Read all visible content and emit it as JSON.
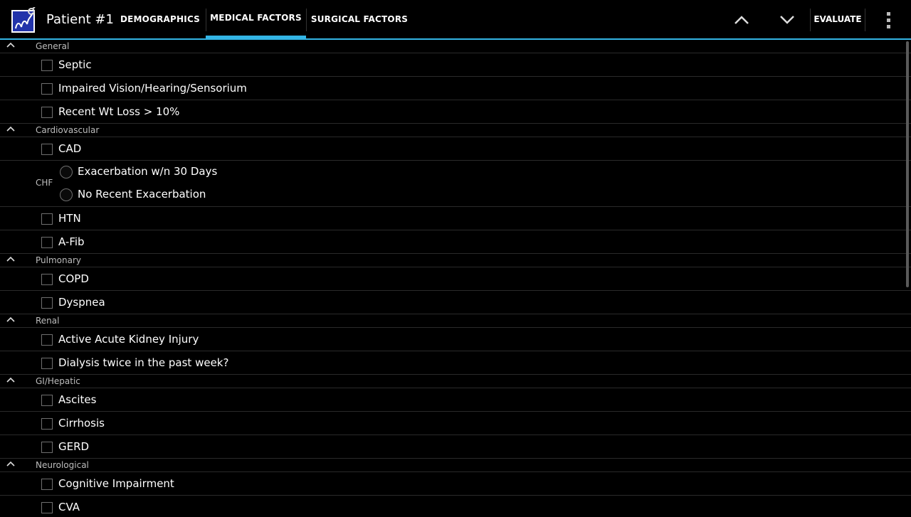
{
  "app": {
    "title": "Patient #1",
    "logo_icon": "vascular-surgery-logo-icon"
  },
  "tabs": [
    {
      "label": "DEMOGRAPHICS",
      "active": false
    },
    {
      "label": "MEDICAL FACTORS",
      "active": true
    },
    {
      "label": "SURGICAL FACTORS",
      "active": false
    }
  ],
  "actions": {
    "evaluate_label": "EVALUATE"
  },
  "colors": {
    "accent": "#33b5e5",
    "background": "#000000",
    "divider": "#2a2a2a"
  },
  "sections": [
    {
      "title": "General",
      "items": [
        "Septic",
        "Impaired Vision/Hearing/Sensorium",
        "Recent Wt Loss > 10%"
      ]
    },
    {
      "title": "Cardiovascular",
      "items": [
        "CAD"
      ],
      "radio_group": {
        "label": "CHF",
        "options": [
          "Exacerbation w/n 30 Days",
          "No Recent Exacerbation"
        ]
      },
      "items_after": [
        "HTN",
        "A-Fib"
      ]
    },
    {
      "title": "Pulmonary",
      "items": [
        "COPD",
        "Dyspnea"
      ]
    },
    {
      "title": "Renal",
      "items": [
        "Active Acute Kidney Injury",
        "Dialysis twice in the past week?"
      ]
    },
    {
      "title": "GI/Hepatic",
      "items": [
        "Ascites",
        "Cirrhosis",
        "GERD"
      ]
    },
    {
      "title": "Neurological",
      "items": [
        "Cognitive Impairment",
        "CVA"
      ]
    }
  ]
}
